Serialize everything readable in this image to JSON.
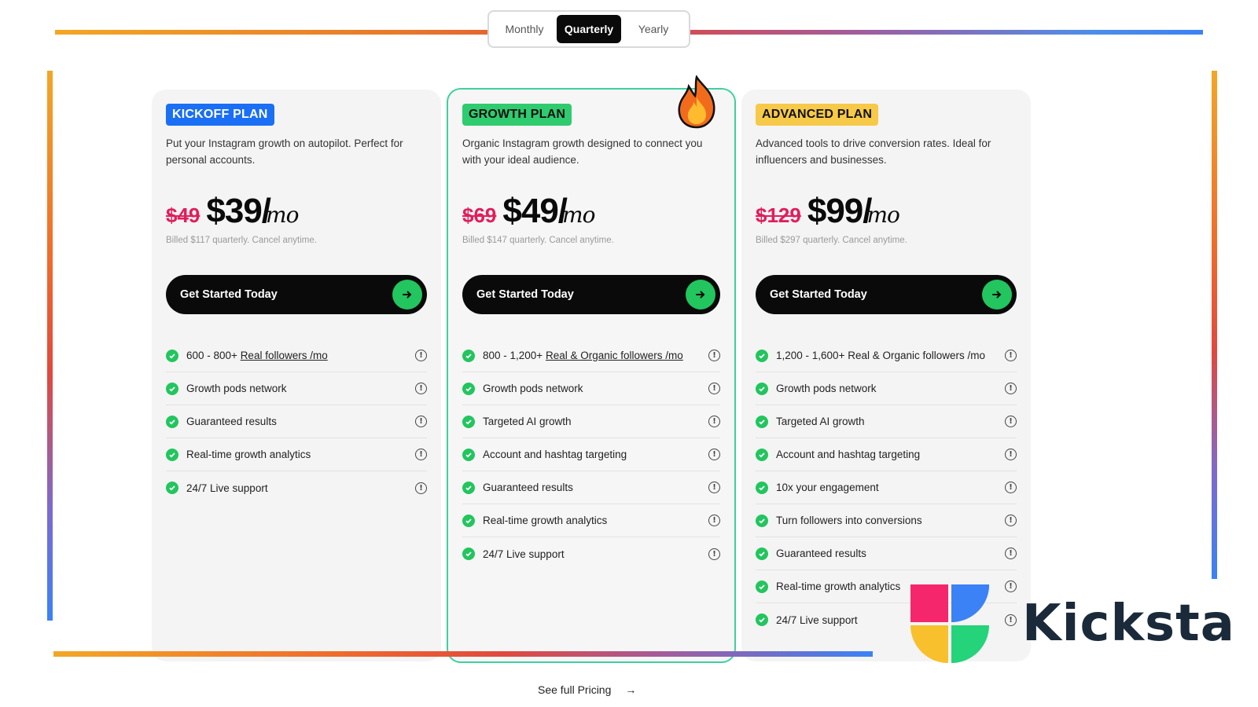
{
  "toggle": {
    "options": [
      "Monthly",
      "Quarterly",
      "Yearly"
    ],
    "selected": "Quarterly"
  },
  "plans": [
    {
      "badge": "KICKOFF PLAN",
      "description": "Put your Instagram growth on autopilot. Perfect for personal accounts.",
      "old_price": "$49",
      "price": "$39/",
      "per": "mo",
      "billed": "Billed $117 quarterly. Cancel anytime.",
      "cta": "Get Started Today",
      "features": [
        {
          "text": "600 - 800+ ",
          "link": "Real followers /mo"
        },
        {
          "text": "Growth pods network"
        },
        {
          "text": "Guaranteed results"
        },
        {
          "text": "Real-time growth analytics"
        },
        {
          "text": "24/7 Live support"
        }
      ]
    },
    {
      "badge": "GROWTH PLAN",
      "description": "Organic Instagram growth designed to connect you with your ideal audience.",
      "old_price": "$69",
      "price": "$49/",
      "per": "mo",
      "billed": "Billed $147 quarterly. Cancel anytime.",
      "cta": "Get Started Today",
      "features": [
        {
          "text": "800 - 1,200+ ",
          "link": "Real & Organic followers /mo"
        },
        {
          "text": "Growth pods network"
        },
        {
          "text": "Targeted AI growth"
        },
        {
          "text": "Account and hashtag targeting"
        },
        {
          "text": "Guaranteed results"
        },
        {
          "text": "Real-time growth analytics"
        },
        {
          "text": "24/7 Live support"
        }
      ]
    },
    {
      "badge": "ADVANCED PLAN",
      "description": "Advanced tools to drive conversion rates. Ideal for influencers and businesses.",
      "old_price": "$129",
      "price": "$99/",
      "per": "mo",
      "billed": "Billed $297 quarterly. Cancel anytime.",
      "cta": "Get Started Today",
      "features": [
        {
          "text": "1,200 - 1,600+ Real & Organic followers /mo"
        },
        {
          "text": "Growth pods network"
        },
        {
          "text": "Targeted AI growth"
        },
        {
          "text": "Account and hashtag targeting"
        },
        {
          "text": "10x your engagement"
        },
        {
          "text": "Turn followers into conversions"
        },
        {
          "text": "Guaranteed results"
        },
        {
          "text": "Real-time growth analytics"
        },
        {
          "text": "24/7 Live support"
        }
      ]
    }
  ],
  "footer": {
    "see_full_pricing": "See full Pricing",
    "arrow": "→"
  },
  "logo": {
    "wordmark": "Kicksta"
  },
  "icons": {
    "check": "check-circle-icon",
    "info": "info-circle-icon",
    "arrow": "arrow-right-icon",
    "fire": "fire-icon"
  },
  "colors": {
    "kickoff_badge": "#1a6ff5",
    "growth_badge": "#2fcb6f",
    "advanced_badge": "#f7c948",
    "old_price": "#e21d5b",
    "cta_arrow": "#22c55e",
    "featured_border": "#3fd0a0"
  }
}
